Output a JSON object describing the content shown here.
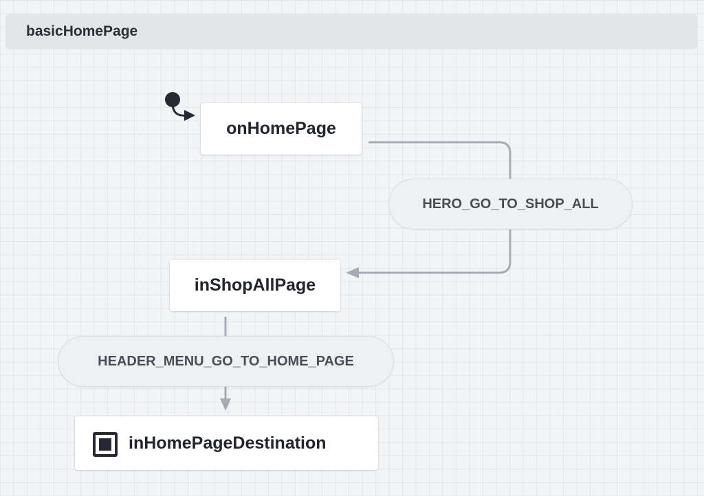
{
  "machine": {
    "name": "basicHomePage"
  },
  "states": {
    "on_home_page": "onHomePage",
    "in_shop_all_page": "inShopAllPage",
    "in_home_page_destination": "inHomePageDestination"
  },
  "events": {
    "hero_go_to_shop_all": "HERO_GO_TO_SHOP_ALL",
    "header_menu_go_to_home_page": "HEADER_MENU_GO_TO_HOME_PAGE"
  },
  "colors": {
    "edge": "#a7abb6",
    "initial_marker": "#262833",
    "state_text": "#23252e",
    "event_text": "#4a4d57"
  }
}
